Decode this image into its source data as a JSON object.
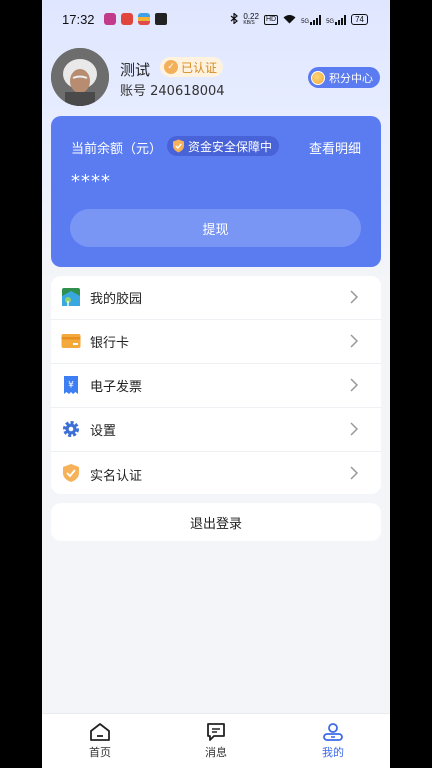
{
  "status_bar": {
    "time": "17:32",
    "net_speed": "0.22",
    "net_unit": "KB/S",
    "hd": "HD",
    "signal": "5G",
    "battery": "74"
  },
  "profile": {
    "name": "测试",
    "verified_label": "已认证",
    "account": "账号 240618004",
    "points_center": "积分中心"
  },
  "balance_card": {
    "label": "当前余额（元）",
    "safety_badge": "资金安全保障中",
    "detail_link": "查看明细",
    "amount_masked": "****",
    "withdraw_button": "提现"
  },
  "menu": [
    {
      "label": "我的胶园",
      "icon": "map-icon"
    },
    {
      "label": "银行卡",
      "icon": "bank-card-icon"
    },
    {
      "label": "电子发票",
      "icon": "invoice-icon"
    },
    {
      "label": "设置",
      "icon": "gear-icon"
    },
    {
      "label": "实名认证",
      "icon": "shield-check-icon"
    }
  ],
  "logout_button": "退出登录",
  "tabs": [
    {
      "label": "首页",
      "icon": "home-icon"
    },
    {
      "label": "消息",
      "icon": "message-icon"
    },
    {
      "label": "我的",
      "icon": "user-icon",
      "active": true
    }
  ],
  "colors": {
    "primary": "#5b7cf0",
    "active_tab": "#3f6ae8",
    "badge_orange": "#d58a22"
  }
}
